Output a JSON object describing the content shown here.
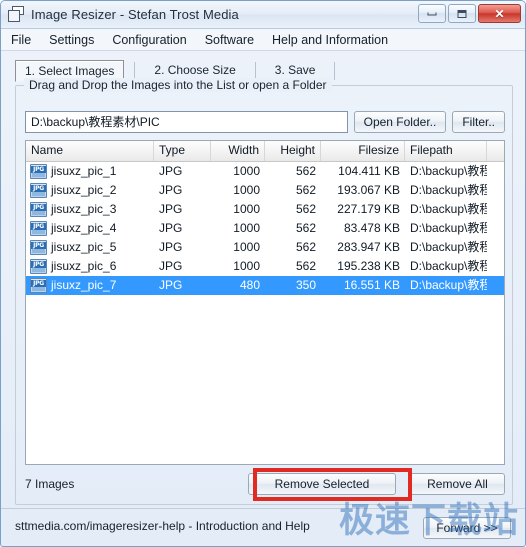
{
  "window": {
    "title": "Image Resizer - Stefan Trost Media",
    "icon": "window-cascade-icon",
    "controls": {
      "minimize": "minimize-icon",
      "maximize": "maximize-icon",
      "close": "✕"
    }
  },
  "menu": {
    "items": [
      {
        "label": "File"
      },
      {
        "label": "Settings"
      },
      {
        "label": "Configuration"
      },
      {
        "label": "Software"
      },
      {
        "label": "Help and Information"
      }
    ]
  },
  "tabs": [
    {
      "label": "1. Select Images",
      "active": true
    },
    {
      "label": "2. Choose Size",
      "active": false
    },
    {
      "label": "3. Save",
      "active": false
    }
  ],
  "groupbox": {
    "title": "Drag and Drop the Images into the List or open a Folder"
  },
  "path": {
    "value": "D:\\backup\\教程素材\\PIC",
    "placeholder": "",
    "open_folder_label": "Open Folder..",
    "filter_label": "Filter.."
  },
  "list": {
    "columns": [
      "Name",
      "Type",
      "Width",
      "Height",
      "Filesize",
      "Filepath",
      ""
    ],
    "rows": [
      {
        "icon": "jpg-file-icon",
        "name": "jisuxz_pic_1",
        "type": "JPG",
        "width": "1000",
        "height": "562",
        "filesize": "104.411 KB",
        "filepath": "D:\\backup\\教程…",
        "selected": false
      },
      {
        "icon": "jpg-file-icon",
        "name": "jisuxz_pic_2",
        "type": "JPG",
        "width": "1000",
        "height": "562",
        "filesize": "193.067 KB",
        "filepath": "D:\\backup\\教程…",
        "selected": false
      },
      {
        "icon": "jpg-file-icon",
        "name": "jisuxz_pic_3",
        "type": "JPG",
        "width": "1000",
        "height": "562",
        "filesize": "227.179 KB",
        "filepath": "D:\\backup\\教程…",
        "selected": false
      },
      {
        "icon": "jpg-file-icon",
        "name": "jisuxz_pic_4",
        "type": "JPG",
        "width": "1000",
        "height": "562",
        "filesize": "83.478 KB",
        "filepath": "D:\\backup\\教程…",
        "selected": false
      },
      {
        "icon": "jpg-file-icon",
        "name": "jisuxz_pic_5",
        "type": "JPG",
        "width": "1000",
        "height": "562",
        "filesize": "283.947 KB",
        "filepath": "D:\\backup\\教程…",
        "selected": false
      },
      {
        "icon": "jpg-file-icon",
        "name": "jisuxz_pic_6",
        "type": "JPG",
        "width": "1000",
        "height": "562",
        "filesize": "195.238 KB",
        "filepath": "D:\\backup\\教程…",
        "selected": false
      },
      {
        "icon": "jpg-file-icon",
        "name": "jisuxz_pic_7",
        "type": "JPG",
        "width": "480",
        "height": "350",
        "filesize": "16.551 KB",
        "filepath": "D:\\backup\\教程…",
        "selected": true
      }
    ]
  },
  "footer": {
    "images_count": "7 Images",
    "remove_selected_label": "Remove Selected",
    "remove_all_label": "Remove All"
  },
  "statusbar": {
    "text": "sttmedia.com/imageresizer-help - Introduction and Help",
    "forward_label": "Forward >>"
  },
  "watermark": {
    "text": "极速下载站"
  },
  "colors": {
    "selection_blue": "#3399ff",
    "annotation_red": "#e02a22",
    "watermark_blue": "#2f6db8",
    "close_button_red": "#c8372a"
  }
}
